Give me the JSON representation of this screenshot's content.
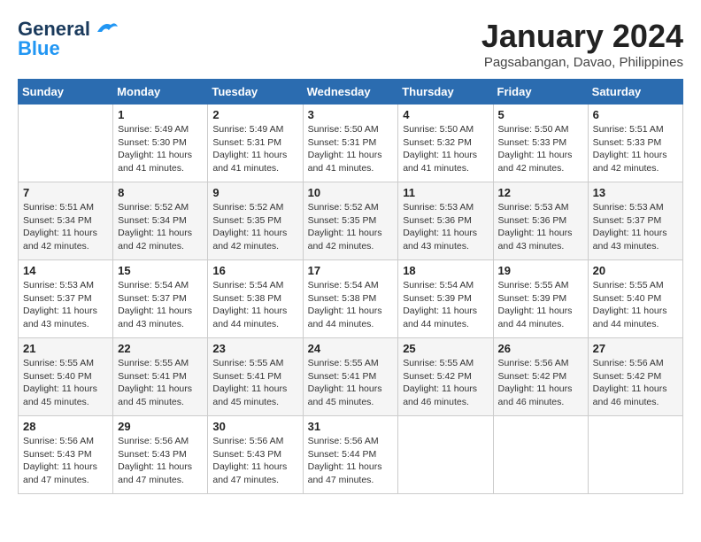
{
  "logo": {
    "line1": "General",
    "line2": "Blue"
  },
  "title": "January 2024",
  "subtitle": "Pagsabangan, Davao, Philippines",
  "days_of_week": [
    "Sunday",
    "Monday",
    "Tuesday",
    "Wednesday",
    "Thursday",
    "Friday",
    "Saturday"
  ],
  "weeks": [
    [
      {
        "day": "",
        "sunrise": "",
        "sunset": "",
        "daylight": ""
      },
      {
        "day": "1",
        "sunrise": "Sunrise: 5:49 AM",
        "sunset": "Sunset: 5:30 PM",
        "daylight": "Daylight: 11 hours and 41 minutes."
      },
      {
        "day": "2",
        "sunrise": "Sunrise: 5:49 AM",
        "sunset": "Sunset: 5:31 PM",
        "daylight": "Daylight: 11 hours and 41 minutes."
      },
      {
        "day": "3",
        "sunrise": "Sunrise: 5:50 AM",
        "sunset": "Sunset: 5:31 PM",
        "daylight": "Daylight: 11 hours and 41 minutes."
      },
      {
        "day": "4",
        "sunrise": "Sunrise: 5:50 AM",
        "sunset": "Sunset: 5:32 PM",
        "daylight": "Daylight: 11 hours and 41 minutes."
      },
      {
        "day": "5",
        "sunrise": "Sunrise: 5:50 AM",
        "sunset": "Sunset: 5:33 PM",
        "daylight": "Daylight: 11 hours and 42 minutes."
      },
      {
        "day": "6",
        "sunrise": "Sunrise: 5:51 AM",
        "sunset": "Sunset: 5:33 PM",
        "daylight": "Daylight: 11 hours and 42 minutes."
      }
    ],
    [
      {
        "day": "7",
        "sunrise": "Sunrise: 5:51 AM",
        "sunset": "Sunset: 5:34 PM",
        "daylight": "Daylight: 11 hours and 42 minutes."
      },
      {
        "day": "8",
        "sunrise": "Sunrise: 5:52 AM",
        "sunset": "Sunset: 5:34 PM",
        "daylight": "Daylight: 11 hours and 42 minutes."
      },
      {
        "day": "9",
        "sunrise": "Sunrise: 5:52 AM",
        "sunset": "Sunset: 5:35 PM",
        "daylight": "Daylight: 11 hours and 42 minutes."
      },
      {
        "day": "10",
        "sunrise": "Sunrise: 5:52 AM",
        "sunset": "Sunset: 5:35 PM",
        "daylight": "Daylight: 11 hours and 42 minutes."
      },
      {
        "day": "11",
        "sunrise": "Sunrise: 5:53 AM",
        "sunset": "Sunset: 5:36 PM",
        "daylight": "Daylight: 11 hours and 43 minutes."
      },
      {
        "day": "12",
        "sunrise": "Sunrise: 5:53 AM",
        "sunset": "Sunset: 5:36 PM",
        "daylight": "Daylight: 11 hours and 43 minutes."
      },
      {
        "day": "13",
        "sunrise": "Sunrise: 5:53 AM",
        "sunset": "Sunset: 5:37 PM",
        "daylight": "Daylight: 11 hours and 43 minutes."
      }
    ],
    [
      {
        "day": "14",
        "sunrise": "Sunrise: 5:53 AM",
        "sunset": "Sunset: 5:37 PM",
        "daylight": "Daylight: 11 hours and 43 minutes."
      },
      {
        "day": "15",
        "sunrise": "Sunrise: 5:54 AM",
        "sunset": "Sunset: 5:37 PM",
        "daylight": "Daylight: 11 hours and 43 minutes."
      },
      {
        "day": "16",
        "sunrise": "Sunrise: 5:54 AM",
        "sunset": "Sunset: 5:38 PM",
        "daylight": "Daylight: 11 hours and 44 minutes."
      },
      {
        "day": "17",
        "sunrise": "Sunrise: 5:54 AM",
        "sunset": "Sunset: 5:38 PM",
        "daylight": "Daylight: 11 hours and 44 minutes."
      },
      {
        "day": "18",
        "sunrise": "Sunrise: 5:54 AM",
        "sunset": "Sunset: 5:39 PM",
        "daylight": "Daylight: 11 hours and 44 minutes."
      },
      {
        "day": "19",
        "sunrise": "Sunrise: 5:55 AM",
        "sunset": "Sunset: 5:39 PM",
        "daylight": "Daylight: 11 hours and 44 minutes."
      },
      {
        "day": "20",
        "sunrise": "Sunrise: 5:55 AM",
        "sunset": "Sunset: 5:40 PM",
        "daylight": "Daylight: 11 hours and 44 minutes."
      }
    ],
    [
      {
        "day": "21",
        "sunrise": "Sunrise: 5:55 AM",
        "sunset": "Sunset: 5:40 PM",
        "daylight": "Daylight: 11 hours and 45 minutes."
      },
      {
        "day": "22",
        "sunrise": "Sunrise: 5:55 AM",
        "sunset": "Sunset: 5:41 PM",
        "daylight": "Daylight: 11 hours and 45 minutes."
      },
      {
        "day": "23",
        "sunrise": "Sunrise: 5:55 AM",
        "sunset": "Sunset: 5:41 PM",
        "daylight": "Daylight: 11 hours and 45 minutes."
      },
      {
        "day": "24",
        "sunrise": "Sunrise: 5:55 AM",
        "sunset": "Sunset: 5:41 PM",
        "daylight": "Daylight: 11 hours and 45 minutes."
      },
      {
        "day": "25",
        "sunrise": "Sunrise: 5:55 AM",
        "sunset": "Sunset: 5:42 PM",
        "daylight": "Daylight: 11 hours and 46 minutes."
      },
      {
        "day": "26",
        "sunrise": "Sunrise: 5:56 AM",
        "sunset": "Sunset: 5:42 PM",
        "daylight": "Daylight: 11 hours and 46 minutes."
      },
      {
        "day": "27",
        "sunrise": "Sunrise: 5:56 AM",
        "sunset": "Sunset: 5:42 PM",
        "daylight": "Daylight: 11 hours and 46 minutes."
      }
    ],
    [
      {
        "day": "28",
        "sunrise": "Sunrise: 5:56 AM",
        "sunset": "Sunset: 5:43 PM",
        "daylight": "Daylight: 11 hours and 47 minutes."
      },
      {
        "day": "29",
        "sunrise": "Sunrise: 5:56 AM",
        "sunset": "Sunset: 5:43 PM",
        "daylight": "Daylight: 11 hours and 47 minutes."
      },
      {
        "day": "30",
        "sunrise": "Sunrise: 5:56 AM",
        "sunset": "Sunset: 5:43 PM",
        "daylight": "Daylight: 11 hours and 47 minutes."
      },
      {
        "day": "31",
        "sunrise": "Sunrise: 5:56 AM",
        "sunset": "Sunset: 5:44 PM",
        "daylight": "Daylight: 11 hours and 47 minutes."
      },
      {
        "day": "",
        "sunrise": "",
        "sunset": "",
        "daylight": ""
      },
      {
        "day": "",
        "sunrise": "",
        "sunset": "",
        "daylight": ""
      },
      {
        "day": "",
        "sunrise": "",
        "sunset": "",
        "daylight": ""
      }
    ]
  ]
}
